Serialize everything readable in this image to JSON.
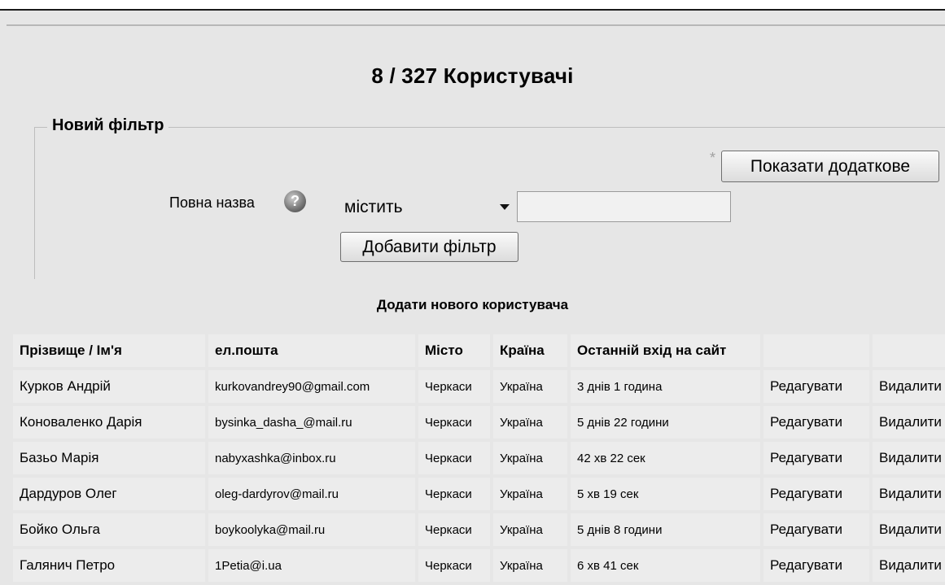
{
  "page": {
    "title": "8 / 327 Користувачі"
  },
  "filter": {
    "legend": "Новий фільтр",
    "asterisk": "*",
    "show_more_label": "Показати додаткове",
    "field_label": "Повна назва",
    "help_icon": "question-circle-icon",
    "operator_value": "містить",
    "text_value": "",
    "add_filter_label": "Добавити фільтр"
  },
  "add_user_link": "Додати нового користувача",
  "table": {
    "headers": [
      "Прізвище / Ім'я",
      "ел.пошта",
      "Місто",
      "Країна",
      "Останній вхід на сайт",
      "",
      ""
    ],
    "rows": [
      {
        "name": "Курков Андрій",
        "email": "kurkovandrey90@gmail.com",
        "city": "Черкаси",
        "country": "Україна",
        "last_login": "3 днів 1 година",
        "edit": "Редагувати",
        "delete": "Видалити"
      },
      {
        "name": "Коноваленко Дарія",
        "email": "bysinka_dasha_@mail.ru",
        "city": "Черкаси",
        "country": "Україна",
        "last_login": "5 днів 22 години",
        "edit": "Редагувати",
        "delete": "Видалити"
      },
      {
        "name": "Базьо Марія",
        "email": "nabyxashka@inbox.ru",
        "city": "Черкаси",
        "country": "Україна",
        "last_login": "42 хв 22 сек",
        "edit": "Редагувати",
        "delete": "Видалити"
      },
      {
        "name": "Дардуров Олег",
        "email": "oleg-dardyrov@mail.ru",
        "city": "Черкаси",
        "country": "Україна",
        "last_login": "5 хв 19 сек",
        "edit": "Редагувати",
        "delete": "Видалити"
      },
      {
        "name": "Бойко Ольга",
        "email": "boykoolyka@mail.ru",
        "city": "Черкаси",
        "country": "Україна",
        "last_login": "5 днів 8 години",
        "edit": "Редагувати",
        "delete": "Видалити"
      },
      {
        "name": "Галянич Петро",
        "email": "1Petia@i.ua",
        "city": "Черкаси",
        "country": "Україна",
        "last_login": "6 хв 41 сек",
        "edit": "Редагувати",
        "delete": "Видалити"
      }
    ]
  }
}
